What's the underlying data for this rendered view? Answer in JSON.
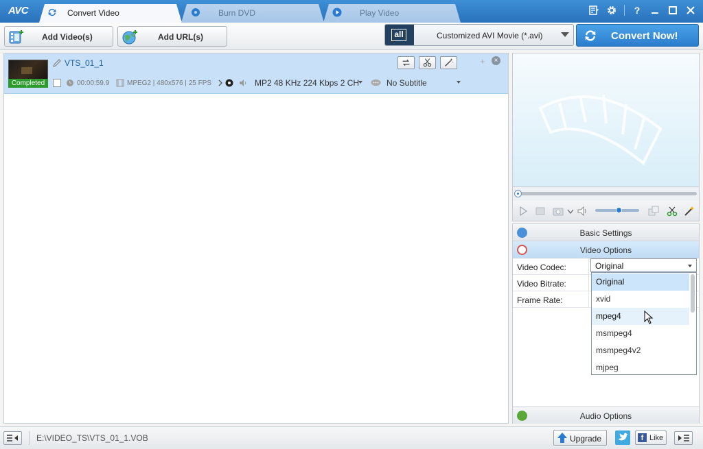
{
  "app": {
    "logo": "AVC",
    "tabs": [
      {
        "label": "Convert Video",
        "active": true
      },
      {
        "label": "Burn DVD",
        "active": false
      },
      {
        "label": "Play Video",
        "active": false
      }
    ]
  },
  "toolbar": {
    "add_videos_label": "Add Video(s)",
    "add_url_label": "Add URL(s)",
    "profile_badge": "all",
    "profile_value": "Customized AVI Movie (*.avi)",
    "convert_label": "Convert Now!"
  },
  "file": {
    "name": "VTS_01_1",
    "status": "Completed",
    "duration": "00:00:59.9",
    "video_info": "MPEG2 | 480x576 | 25 FPS",
    "audio_track": "MP2 48 KHz 224 Kbps 2 CH",
    "subtitle": "No Subtitle"
  },
  "settings": {
    "basic_title": "Basic Settings",
    "video_title": "Video Options",
    "audio_title": "Audio Options",
    "rows": [
      {
        "label": "Video Codec:"
      },
      {
        "label": "Video Bitrate:"
      },
      {
        "label": "Frame Rate:"
      }
    ],
    "codec_value": "Original",
    "codec_options": [
      "Original",
      "xvid",
      "mpeg4",
      "msmpeg4",
      "msmpeg4v2",
      "mjpeg"
    ],
    "selected_option": "Original",
    "hovered_option": "mpeg4"
  },
  "status": {
    "path": "E:\\VIDEO_TS\\VTS_01_1.VOB",
    "upgrade_label": "Upgrade",
    "like_label": "Like"
  },
  "colors": {
    "accent": "#2b7dcc",
    "title_bar": "#3d8fd6",
    "selection": "#c8e1f8",
    "completed": "#2c9a2c"
  }
}
